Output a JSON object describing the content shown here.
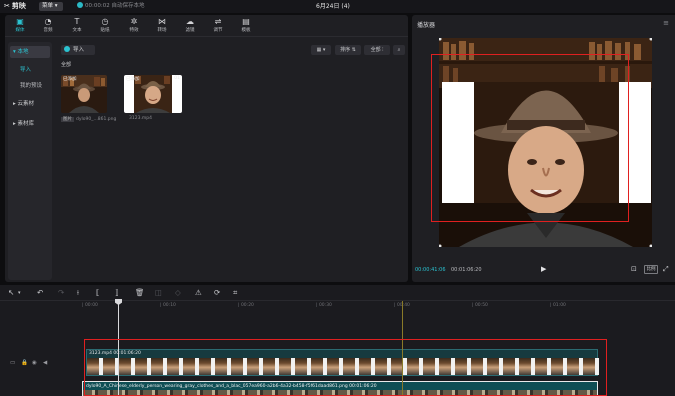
{
  "app": {
    "name": "剪映",
    "menu_label": "菜单",
    "autosave": "00:00:02 自动保存本地",
    "project_title": "6月24日 (4)"
  },
  "tabs": [
    {
      "label": "媒体",
      "icon": "media-icon",
      "active": true
    },
    {
      "label": "音频",
      "icon": "audio-icon"
    },
    {
      "label": "文本",
      "icon": "text-icon"
    },
    {
      "label": "贴纸",
      "icon": "sticker-icon"
    },
    {
      "label": "特效",
      "icon": "effects-icon"
    },
    {
      "label": "转场",
      "icon": "transition-icon"
    },
    {
      "label": "滤镜",
      "icon": "filter-icon"
    },
    {
      "label": "调节",
      "icon": "adjust-icon"
    },
    {
      "label": "模板",
      "icon": "template-icon"
    }
  ],
  "sidebar": {
    "items": [
      {
        "label": "▾ 本地",
        "active": true
      },
      {
        "label": "导入"
      },
      {
        "label": "我的预设"
      },
      {
        "label": "▸ 云素材"
      },
      {
        "label": "▸ 素材库"
      }
    ]
  },
  "media": {
    "import_label": "导入",
    "view_label": "▦ ▾",
    "sort_label": "排序 ⇅",
    "all_filter_label": "全部 ⫶",
    "all_label": "全部",
    "items": [
      {
        "name": "dylo90_...861.png",
        "tag": "已添加",
        "type_badge": "图片"
      },
      {
        "name": "3123.mp4",
        "tag": "已添加",
        "duration": "01"
      }
    ]
  },
  "player": {
    "title": "播放器",
    "time_current": "00:00:41:06",
    "time_total": "00:01:06:20",
    "ratio_label": "比例"
  },
  "timeline": {
    "ruler_labels": [
      "| 00:00",
      "| 00:10",
      "| 00:20",
      "| 00:30",
      "| 00:40",
      "| 00:50",
      "| 01:00"
    ],
    "clip1_label": "3123.mp4   00:01:06:20",
    "clip2_label": "dylo90_A_Chinese_elderly_person_wearing_gray_clothes_and_a_blac_057ea960-a2b6-4a32-b458-f5f61daad861.png   00:01:06:20"
  },
  "colors": {
    "accent": "#2bc3d1",
    "highlight_box": "#e02020"
  }
}
